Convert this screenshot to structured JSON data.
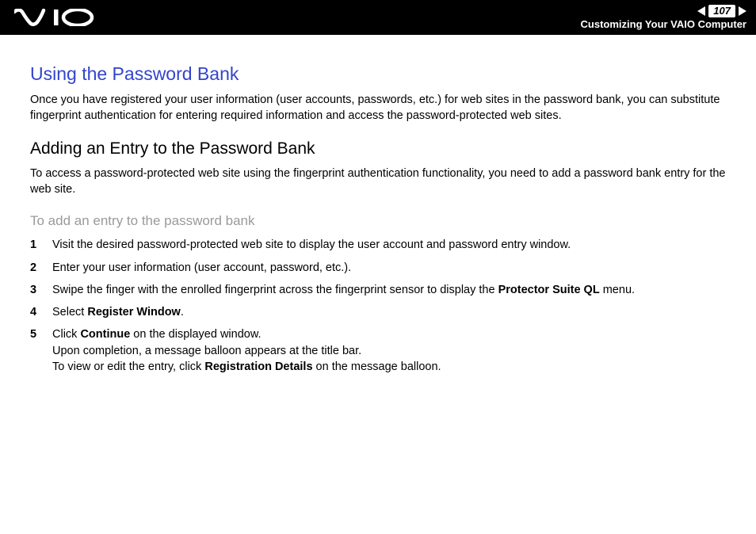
{
  "header": {
    "page_number": "107",
    "section": "Customizing Your VAIO Computer"
  },
  "content": {
    "title": "Using the Password Bank",
    "intro": "Once you have registered your user information (user accounts, passwords, etc.) for web sites in the password bank, you can substitute fingerprint authentication for entering required information and access the password-protected web sites.",
    "subtitle": "Adding an Entry to the Password Bank",
    "subintro": "To access a password-protected web site using the fingerprint authentication functionality, you need to add a password bank entry for the web site.",
    "procedure_heading": "To add an entry to the password bank",
    "steps": [
      {
        "n": "1",
        "html": "Visit the desired password-protected web site to display the user account and password entry window."
      },
      {
        "n": "2",
        "html": "Enter your user information (user account, password, etc.)."
      },
      {
        "n": "3",
        "html": "Swipe the finger with the enrolled fingerprint across the fingerprint sensor to display the <b>Protector Suite QL</b> menu."
      },
      {
        "n": "4",
        "html": "Select <b>Register Window</b>."
      },
      {
        "n": "5",
        "html": "Click <b>Continue</b> on the displayed window.<br>Upon completion, a message balloon appears at the title bar.<br>To view or edit the entry, click <b>Registration Details</b> on the message balloon."
      }
    ]
  }
}
